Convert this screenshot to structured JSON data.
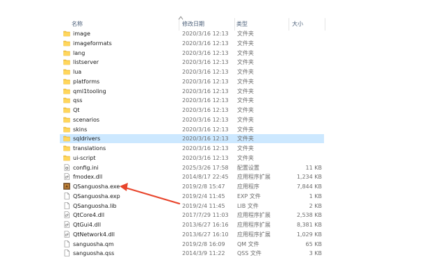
{
  "columns": {
    "name": "名称",
    "date": "修改日期",
    "type": "类型",
    "size": "大小"
  },
  "files": [
    {
      "name": "image",
      "date": "2020/3/16 12:13",
      "type": "文件夹",
      "size": "",
      "icon": "folder-icon"
    },
    {
      "name": "imageformats",
      "date": "2020/3/16 12:13",
      "type": "文件夹",
      "size": "",
      "icon": "folder-icon"
    },
    {
      "name": "lang",
      "date": "2020/3/16 12:13",
      "type": "文件夹",
      "size": "",
      "icon": "folder-icon"
    },
    {
      "name": "listserver",
      "date": "2020/3/16 12:13",
      "type": "文件夹",
      "size": "",
      "icon": "folder-icon"
    },
    {
      "name": "lua",
      "date": "2020/3/16 12:13",
      "type": "文件夹",
      "size": "",
      "icon": "folder-icon"
    },
    {
      "name": "platforms",
      "date": "2020/3/16 12:13",
      "type": "文件夹",
      "size": "",
      "icon": "folder-icon"
    },
    {
      "name": "qml1tooling",
      "date": "2020/3/16 12:13",
      "type": "文件夹",
      "size": "",
      "icon": "folder-icon"
    },
    {
      "name": "qss",
      "date": "2020/3/16 12:13",
      "type": "文件夹",
      "size": "",
      "icon": "folder-icon"
    },
    {
      "name": "Qt",
      "date": "2020/3/16 12:13",
      "type": "文件夹",
      "size": "",
      "icon": "folder-icon"
    },
    {
      "name": "scenarios",
      "date": "2020/3/16 12:13",
      "type": "文件夹",
      "size": "",
      "icon": "folder-icon"
    },
    {
      "name": "skins",
      "date": "2020/3/16 12:13",
      "type": "文件夹",
      "size": "",
      "icon": "folder-icon"
    },
    {
      "name": "sqldrivers",
      "date": "2020/3/16 12:13",
      "type": "文件夹",
      "size": "",
      "icon": "folder-icon",
      "selected": true
    },
    {
      "name": "translations",
      "date": "2020/3/16 12:13",
      "type": "文件夹",
      "size": "",
      "icon": "folder-icon"
    },
    {
      "name": "ui-script",
      "date": "2020/3/16 12:13",
      "type": "文件夹",
      "size": "",
      "icon": "folder-icon"
    },
    {
      "name": "config.ini",
      "date": "2025/3/26 17:58",
      "type": "配置设置",
      "size": "11 KB",
      "icon": "config-file-icon"
    },
    {
      "name": "fmodex.dll",
      "date": "2014/8/17 22:45",
      "type": "应用程序扩展",
      "size": "1,234 KB",
      "icon": "dll-file-icon"
    },
    {
      "name": "QSanguosha.exe",
      "date": "2019/2/8 15:47",
      "type": "应用程序",
      "size": "7,844 KB",
      "icon": "app-exe-icon"
    },
    {
      "name": "QSanguosha.exp",
      "date": "2019/2/4 11:45",
      "type": "EXP 文件",
      "size": "1 KB",
      "icon": "file-icon"
    },
    {
      "name": "QSanguosha.lib",
      "date": "2019/2/4 11:45",
      "type": "LIB 文件",
      "size": "2 KB",
      "icon": "file-icon"
    },
    {
      "name": "QtCore4.dll",
      "date": "2017/7/29 11:03",
      "type": "应用程序扩展",
      "size": "2,538 KB",
      "icon": "dll-file-icon"
    },
    {
      "name": "QtGui4.dll",
      "date": "2013/6/27 16:16",
      "type": "应用程序扩展",
      "size": "8,381 KB",
      "icon": "dll-file-icon"
    },
    {
      "name": "QtNetwork4.dll",
      "date": "2013/6/27 16:10",
      "type": "应用程序扩展",
      "size": "1,029 KB",
      "icon": "dll-file-icon"
    },
    {
      "name": "sanguosha.qm",
      "date": "2019/2/8 16:09",
      "type": "QM 文件",
      "size": "65 KB",
      "icon": "file-icon"
    },
    {
      "name": "sanguosha.qss",
      "date": "2014/3/9 11:22",
      "type": "QSS 文件",
      "size": "3 KB",
      "icon": "file-icon"
    }
  ],
  "colors": {
    "selection": "#cce8ff",
    "folder": "#f5c542",
    "arrow": "#e8452c"
  }
}
